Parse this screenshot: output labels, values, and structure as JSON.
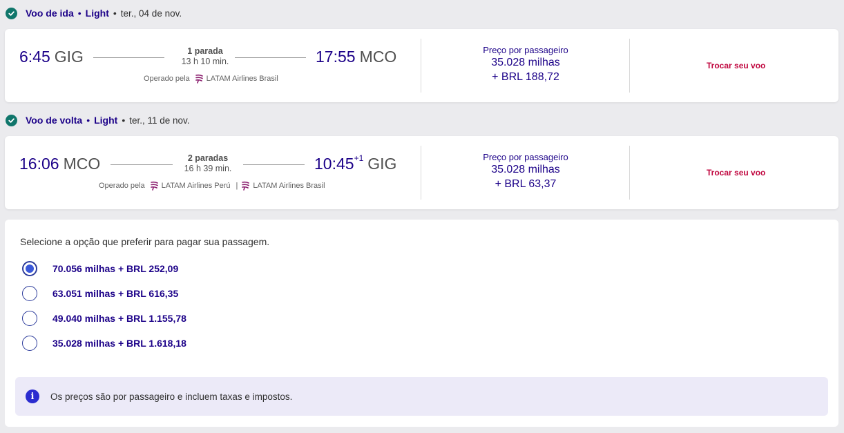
{
  "outbound": {
    "header": {
      "type": "Voo de ida",
      "fare": "Light",
      "date": "ter., 04 de nov."
    },
    "dep_time": "6:45",
    "dep_iata": "GIG",
    "stops": "1 parada",
    "duration": "13 h 10 min.",
    "arr_time": "17:55",
    "arr_iata": "MCO",
    "arr_day_offset": "",
    "operated_label": "Operado pela",
    "airlines": [
      "LATAM Airlines Brasil"
    ],
    "price_label": "Preço por passageiro",
    "price_miles": "35.028 milhas",
    "price_cash": "+ BRL 188,72",
    "change_label": "Trocar seu voo"
  },
  "inbound": {
    "header": {
      "type": "Voo de volta",
      "fare": "Light",
      "date": "ter., 11 de nov."
    },
    "dep_time": "16:06",
    "dep_iata": "MCO",
    "stops": "2 paradas",
    "duration": "16 h 39 min.",
    "arr_time": "10:45",
    "arr_iata": "GIG",
    "arr_day_offset": "+1",
    "operated_label": "Operado pela",
    "airlines": [
      "LATAM Airlines Perú",
      "LATAM Airlines Brasil"
    ],
    "price_label": "Preço por passageiro",
    "price_miles": "35.028 milhas",
    "price_cash": "+ BRL 63,37",
    "change_label": "Trocar seu voo"
  },
  "payment": {
    "intro": "Selecione a opção que preferir para pagar sua passagem.",
    "options": [
      {
        "label": "70.056 milhas + BRL 252,09",
        "selected": true
      },
      {
        "label": "63.051 milhas + BRL 616,35",
        "selected": false
      },
      {
        "label": "49.040 milhas + BRL 1.155,78",
        "selected": false
      },
      {
        "label": "35.028 milhas + BRL 1.618,18",
        "selected": false
      }
    ],
    "info_message": "Os preços são por passageiro e incluem taxas e impostos."
  },
  "colors": {
    "brand": "#1b0088",
    "accent": "#c0073f",
    "success": "#10766b",
    "radio": "#3a58d9"
  }
}
